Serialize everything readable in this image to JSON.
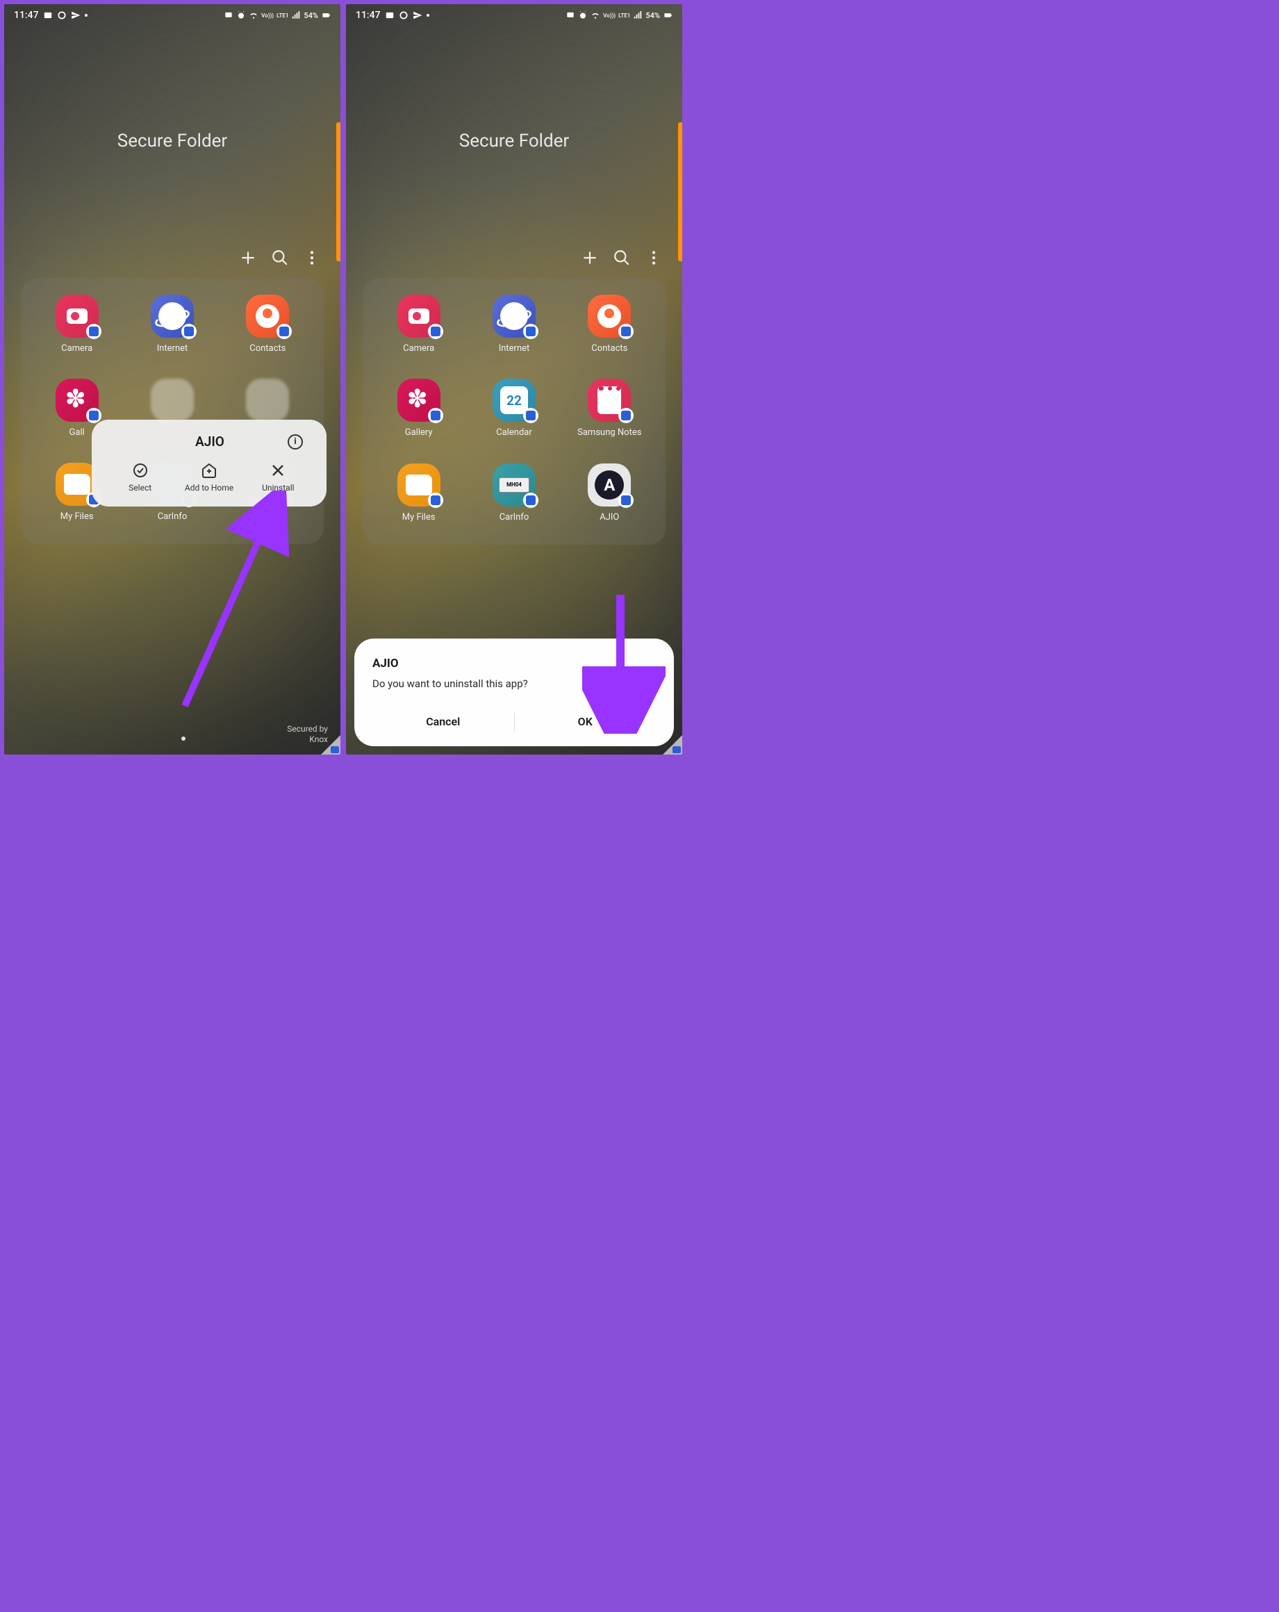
{
  "status_bar": {
    "time": "11:47",
    "battery_text": "54%",
    "lte_label": "LTE1",
    "vo_label": "Vo)))"
  },
  "header": {
    "title": "Secure Folder"
  },
  "toolbar": {
    "add_icon": "plus",
    "search_icon": "search",
    "menu_icon": "more-vert"
  },
  "apps": {
    "row1": [
      {
        "id": "camera",
        "label": "Camera"
      },
      {
        "id": "internet",
        "label": "Internet"
      },
      {
        "id": "contacts",
        "label": "Contacts"
      }
    ],
    "row2_left": [
      {
        "id": "gallery",
        "label": "Gallery"
      },
      {
        "id": "calendar",
        "label": "Calendar",
        "day": "22"
      },
      {
        "id": "notes",
        "label": "Samsung Notes"
      }
    ],
    "row3": [
      {
        "id": "myfiles",
        "label": "My Files"
      },
      {
        "id": "carinfo",
        "label": "CarInfo",
        "plate": "MH04"
      },
      {
        "id": "ajio",
        "label": "AJIO"
      }
    ],
    "gallery_short": "Gall",
    "ajio_short": "A"
  },
  "context_menu": {
    "app_name": "AJIO",
    "actions": {
      "select": "Select",
      "add_home": "Add to Home",
      "uninstall": "Uninstall"
    }
  },
  "dialog": {
    "title": "AJIO",
    "body": "Do you want to uninstall this app?",
    "cancel": "Cancel",
    "ok": "OK"
  },
  "footer": {
    "secured_by": "Secured by",
    "knox": "Knox"
  }
}
